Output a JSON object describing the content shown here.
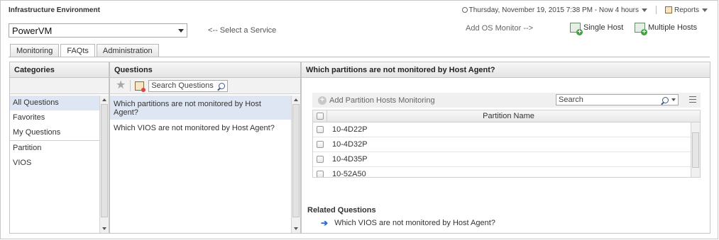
{
  "page": {
    "title": "Infrastructure Environment"
  },
  "topbar": {
    "time_range": "Thursday, November 19, 2015 7:38 PM - Now 4 hours",
    "reports_label": "Reports"
  },
  "service": {
    "selected": "PowerVM",
    "hint": "<-- Select a Service"
  },
  "os_monitor": {
    "hint": "Add OS Monitor -->",
    "single_host_label": "Single Host",
    "multiple_hosts_label": "Multiple Hosts"
  },
  "tabs": [
    {
      "label": "Monitoring",
      "active": false
    },
    {
      "label": "FAQts",
      "active": true
    },
    {
      "label": "Administration",
      "active": false
    }
  ],
  "categories": {
    "header": "Categories",
    "items": [
      {
        "label": "All Questions",
        "selected": true
      },
      {
        "label": "Favorites",
        "selected": false
      },
      {
        "label": "My Questions",
        "selected": false
      },
      {
        "label": "Partition",
        "selected": false
      },
      {
        "label": "VIOS",
        "selected": false
      }
    ]
  },
  "questions": {
    "header": "Questions",
    "search_placeholder": "Search Questions",
    "items": [
      {
        "label": "Which partitions are not monitored by Host Agent?",
        "selected": true
      },
      {
        "label": "Which VIOS are not monitored by Host Agent?",
        "selected": false
      }
    ]
  },
  "detail": {
    "header": "Which partitions are not monitored by Host Agent?",
    "add_button_label": "Add Partition Hosts Monitoring",
    "search_placeholder": "Search",
    "column_header": "Partition Name",
    "rows": [
      "10-4D22P",
      "10-4D32P",
      "10-4D35P",
      "10-52A50"
    ],
    "related_title": "Related Questions",
    "related_items": [
      "Which VIOS are not monitored by Host Agent?"
    ]
  },
  "icons": {
    "star": "star-icon",
    "edit": "edit-question-icon",
    "search": "search-icon",
    "add": "add-icon",
    "arrow": "arrow-right-icon",
    "columns": "columns-icon"
  }
}
